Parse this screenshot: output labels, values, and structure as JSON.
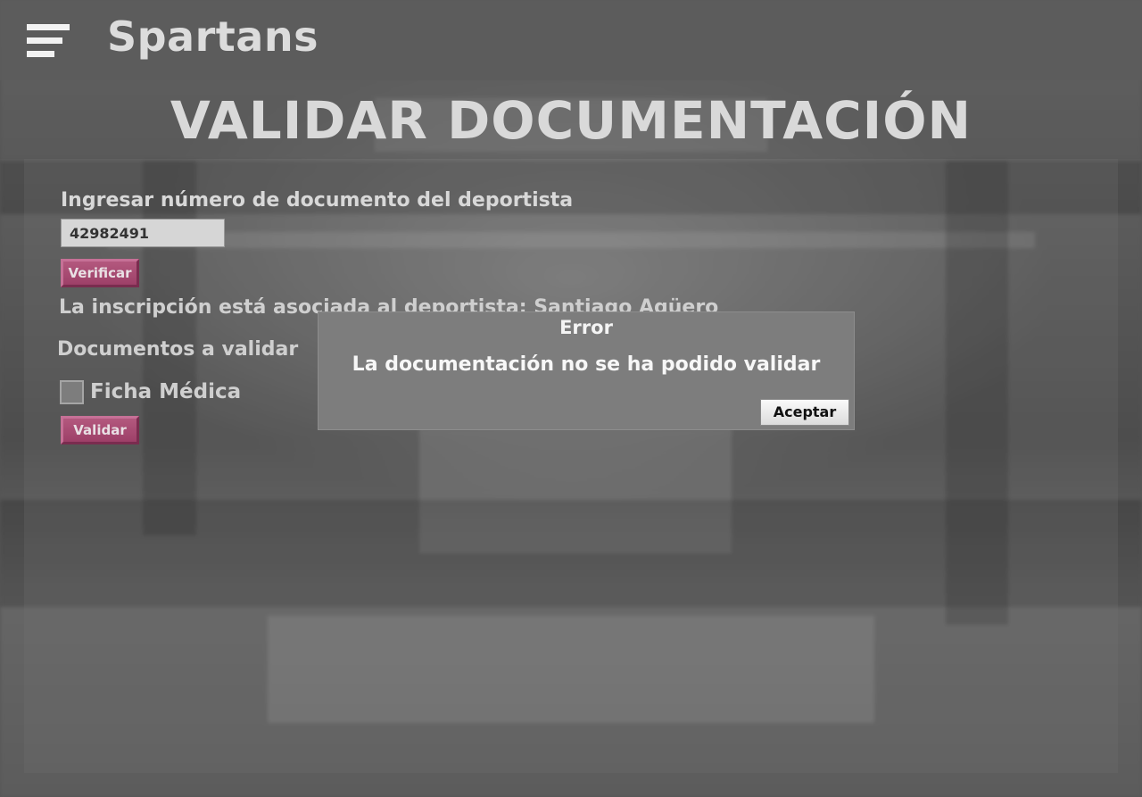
{
  "header": {
    "brand": "Spartans",
    "menu_icon": "hamburger-menu-icon"
  },
  "page": {
    "title": "VALIDAR DOCUMENTACIÓN"
  },
  "form": {
    "document_label": "Ingresar número de documento del deportista",
    "document_value": "42982491",
    "verify_label": "Verificar",
    "association_text": "La inscripción está asociada al deportista: Santiago Agüero",
    "documents_heading": "Documentos a validar",
    "documents": [
      {
        "label": "Ficha Médica",
        "checked": false
      }
    ],
    "validate_label": "Validar"
  },
  "dialog": {
    "title": "Error",
    "message": "La documentación no se ha podido validar",
    "accept_label": "Aceptar"
  },
  "colors": {
    "accent_button": "#a84a74",
    "dialog_bg": "#7d7d7d",
    "text_light": "#d8d8d8"
  }
}
